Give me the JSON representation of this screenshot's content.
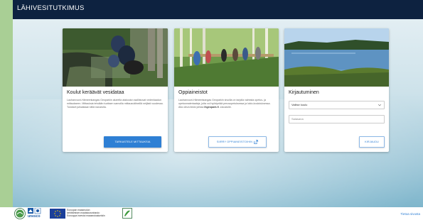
{
  "header": {
    "title": "LÄHIVESITUTKIMUS"
  },
  "cards": [
    {
      "title": "Koulut keräävät vesidataa",
      "text": "Lauhanvuori-Hämeenkangas Geoparkin alueella aiakoulut osallistuvat vedenlaadun mittaukseen. Mittauksia tehdään tuottaen samoilla mittausvälineillä neljästi vuodessa. Tulokset julkaistaan tällä sivustolla.",
      "button": "TARKASTELE MITTAUKSIA"
    },
    {
      "title": "Oppiaineistot",
      "text_before": "Lauhanvuori-Hämeenkangas Geoparkin sivuilla on tarjolla valmista opetus- ja opetusmateriaaleja, joita voi hyödyntää perusopetuksessa ja lukio-koulutuksessa. Alla oleva linkki johtaa ",
      "text_bold": "lhgeopark.fi",
      "text_after": " -sivustolle.",
      "button": "SIIRRY OPPIAINEISTOIHIN"
    },
    {
      "title": "Kirjautuminen",
      "select_value": "Valitse koulu",
      "password_placeholder": "Salasana",
      "button": "KIRJAUDU"
    }
  ],
  "footer": {
    "badge_unesco": "unesco",
    "eu_text": [
      "Euroopan maaseudun",
      "kehittämisen maatalousrahasto:",
      "Eurooppa investoi maaseutualueisiin"
    ],
    "link": "Tietoa sivusta"
  },
  "colors": {
    "topbar": "#0d2240",
    "accent": "#2e7fd4",
    "side": "#a9cf95"
  },
  "icons": [
    "external-link-icon",
    "chevron-down-icon",
    "geopark-logo-icon",
    "unesco-logo-icon",
    "eu-flag-icon",
    "leader-logo-icon"
  ]
}
